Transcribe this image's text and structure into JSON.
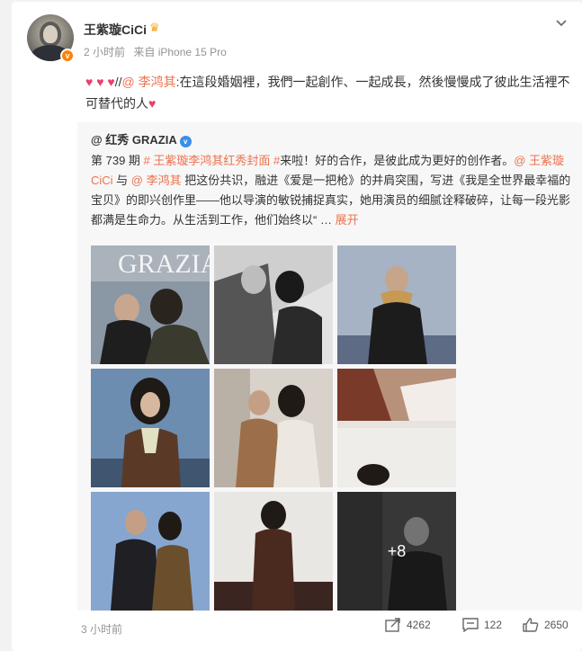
{
  "post": {
    "author": "王紫璇CiCi",
    "time": "2 小时前",
    "source": "来自 iPhone 15 Pro",
    "hearts_prefix": "♥ ♥ ♥",
    "slashes": "//",
    "mention": "@ 李鸿其",
    "text": ":在這段婚姻裡，我們一起創作、一起成長，然後慢慢成了彼此生活裡不可替代的人",
    "heart_suffix": "♥"
  },
  "repost": {
    "author": "@ 红秀 GRAZIA",
    "text_prefix": "第 739 期",
    "tag": "# 王紫璇李鸿其红秀封面 #",
    "text_1": "来啦！好的合作，是彼此成为更好的创作者。",
    "mention_1": "@ 王紫璇 CiCi",
    "text_2": " 与 ",
    "mention_2": "@ 李鸿其",
    "text_3": " 把这份共识，融进《爱是一把枪》的并肩突围，写进《我是全世界最幸福的宝贝》的即兴创作里——他以导演的敏锐捕捉真实，她用演员的细腻诠释破碎，让每一段光影都满是生命力。从生活到工作，他们始终以“ …",
    "expand_label": "展开",
    "more_photos": "+8",
    "brand": "GRAZIA"
  },
  "footer": {
    "time": "3 小时前",
    "shares": "4262",
    "comments": "122",
    "likes": "2650"
  },
  "colors": {
    "accent": "#eb7350",
    "heart": "#ec3e6b",
    "verified_orange": "#ff8200",
    "verified_blue": "#3a8fe6"
  },
  "icons": [
    "chevron-down-icon",
    "crown-icon",
    "share-icon",
    "comment-icon",
    "like-icon",
    "verified-badge-icon"
  ]
}
